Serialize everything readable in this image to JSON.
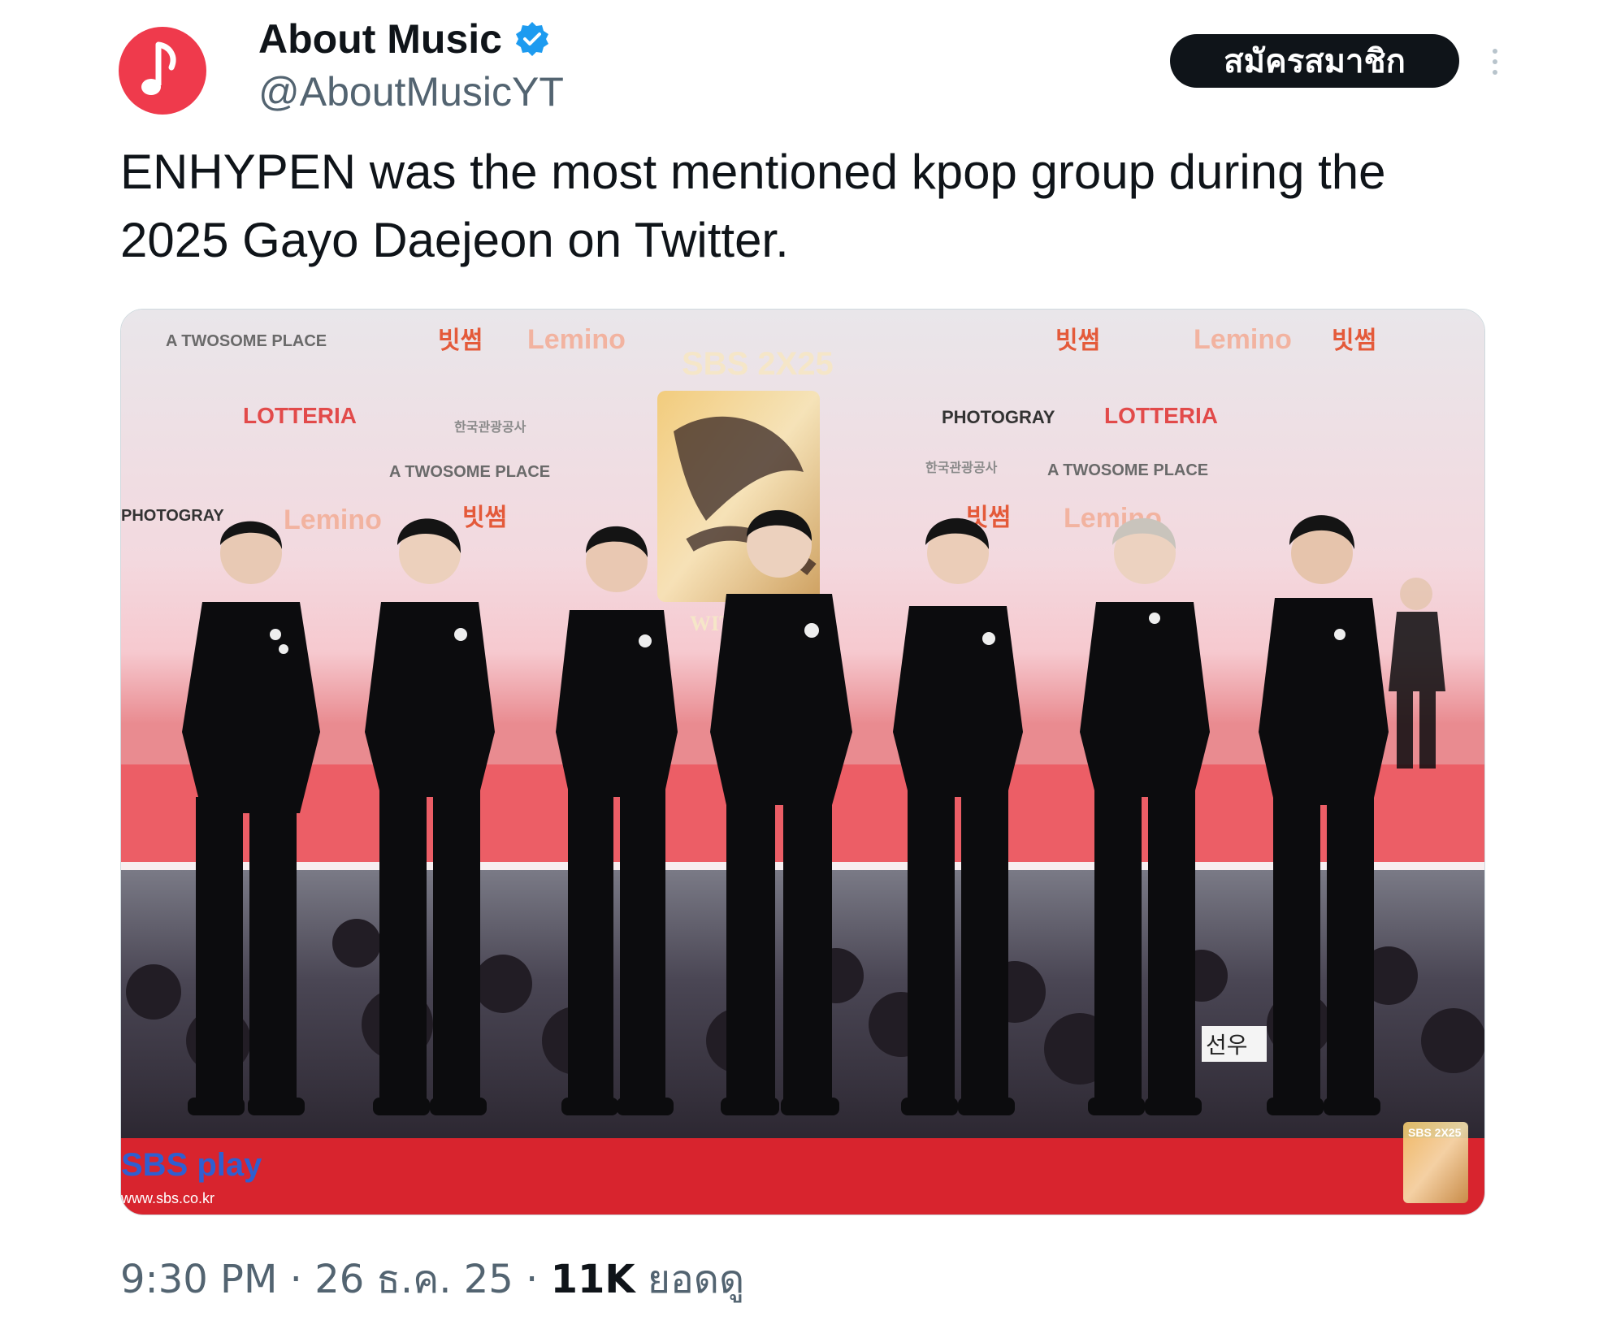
{
  "author": {
    "display_name": "About Music",
    "handle": "@AboutMusicYT",
    "verified": true,
    "avatar_icon": "music-note-icon",
    "avatar_color": "#ef3a4c"
  },
  "header": {
    "subscribe_label": "สมัครสมาชิก",
    "more_icon": "more-vertical-icon"
  },
  "tweet": {
    "text": "ENHYPEN was the most mentioned kpop group during the 2025 Gayo Daejeon on Twitter."
  },
  "photo": {
    "backdrop_sponsors": [
      "A TWOSOME PLACE",
      "빗썸",
      "Lemino",
      "LOTTERIA",
      "PHOTOGRAY",
      "한국관광공사"
    ],
    "event_logo": "SBS 2X25",
    "event_logo_sub": "WITH",
    "watermark_brand": "SBS play",
    "watermark_url": "www.sbs.co.kr",
    "fan_sign": "선우"
  },
  "meta": {
    "time": "9:30 PM",
    "separator": " · ",
    "date": "26 ธ.ค. 25",
    "views_count": "11K",
    "views_label": "ยอดดู"
  },
  "colors": {
    "text_primary": "#0f1419",
    "text_secondary": "#536471",
    "verified_blue": "#1d9bf0",
    "carpet_red": "#d8242e"
  }
}
